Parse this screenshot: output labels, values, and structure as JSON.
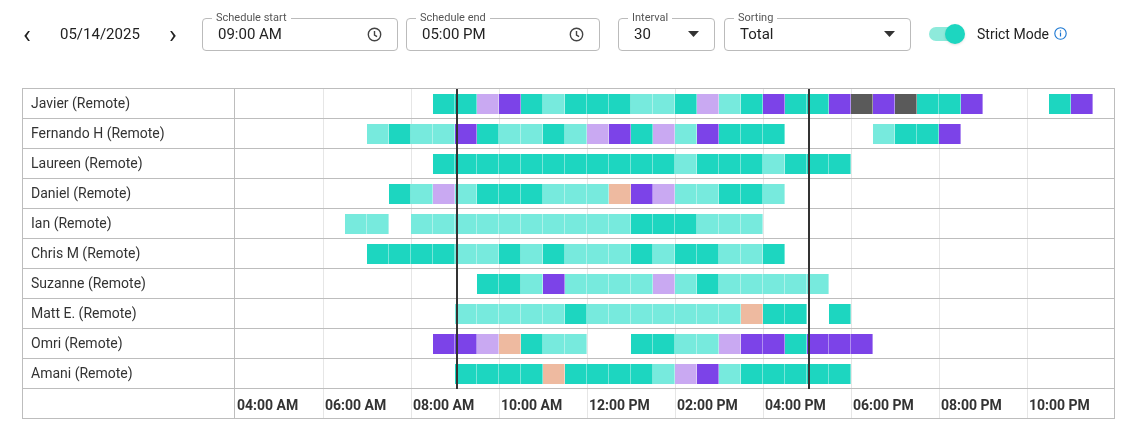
{
  "date_nav": {
    "prev": "‹",
    "date": "05/14/2025",
    "next": "›"
  },
  "schedule_start": {
    "label": "Schedule start",
    "value": "09:00 AM"
  },
  "schedule_end": {
    "label": "Schedule end",
    "value": "05:00 PM"
  },
  "interval": {
    "label": "Interval",
    "value": "30"
  },
  "sorting": {
    "label": "Sorting",
    "value": "Total"
  },
  "strict_mode": {
    "label": "Strict Mode",
    "on": true
  },
  "rows": [
    {
      "name": "Javier (Remote)",
      "slots": [
        {
          "kind": "gap"
        },
        {
          "kind": "gap"
        },
        {
          "kind": "gap"
        },
        {
          "kind": "gap"
        },
        {
          "kind": "gap"
        },
        {
          "kind": "gap"
        },
        {
          "kind": "gap"
        },
        {
          "kind": "gap"
        },
        {
          "kind": "gap"
        },
        {
          "kind": "shift",
          "color": "#1dd6c0"
        },
        {
          "kind": "shift",
          "color": "#1dd6c0"
        },
        {
          "kind": "shift",
          "color": "#c9a9f2"
        },
        {
          "kind": "shift",
          "color": "#7c43e8"
        },
        {
          "kind": "shift",
          "color": "#1dd6c0"
        },
        {
          "kind": "shift",
          "color": "#77eadd"
        },
        {
          "kind": "shift",
          "color": "#1dd6c0"
        },
        {
          "kind": "shift",
          "color": "#1dd6c0"
        },
        {
          "kind": "shift",
          "color": "#1dd6c0"
        },
        {
          "kind": "shift",
          "color": "#77eadd"
        },
        {
          "kind": "shift",
          "color": "#77eadd"
        },
        {
          "kind": "shift",
          "color": "#1dd6c0"
        },
        {
          "kind": "shift",
          "color": "#c9a9f2"
        },
        {
          "kind": "shift",
          "color": "#77eadd"
        },
        {
          "kind": "shift",
          "color": "#1dd6c0"
        },
        {
          "kind": "shift",
          "color": "#7c43e8"
        },
        {
          "kind": "shift",
          "color": "#1dd6c0"
        },
        {
          "kind": "shift",
          "color": "#1dd6c0"
        },
        {
          "kind": "shift",
          "color": "#7c43e8"
        },
        {
          "kind": "shift",
          "color": "#5a5a5a"
        },
        {
          "kind": "shift",
          "color": "#7c43e8"
        },
        {
          "kind": "shift",
          "color": "#5a5a5a"
        },
        {
          "kind": "shift",
          "color": "#1dd6c0"
        },
        {
          "kind": "shift",
          "color": "#1dd6c0"
        },
        {
          "kind": "shift",
          "color": "#7c43e8"
        },
        {
          "kind": "gap"
        },
        {
          "kind": "gap"
        },
        {
          "kind": "gap"
        },
        {
          "kind": "shift",
          "color": "#1dd6c0"
        },
        {
          "kind": "shift",
          "color": "#7c43e8"
        }
      ]
    },
    {
      "name": "Fernando H (Remote)",
      "slots": [
        {
          "kind": "gap"
        },
        {
          "kind": "gap"
        },
        {
          "kind": "gap"
        },
        {
          "kind": "gap"
        },
        {
          "kind": "gap"
        },
        {
          "kind": "gap"
        },
        {
          "kind": "shift",
          "color": "#77eadd"
        },
        {
          "kind": "shift",
          "color": "#1dd6c0"
        },
        {
          "kind": "shift",
          "color": "#77eadd"
        },
        {
          "kind": "shift",
          "color": "#77eadd"
        },
        {
          "kind": "shift",
          "color": "#7c43e8"
        },
        {
          "kind": "shift",
          "color": "#1dd6c0"
        },
        {
          "kind": "shift",
          "color": "#77eadd"
        },
        {
          "kind": "shift",
          "color": "#77eadd"
        },
        {
          "kind": "shift",
          "color": "#1dd6c0"
        },
        {
          "kind": "shift",
          "color": "#77eadd"
        },
        {
          "kind": "shift",
          "color": "#c9a9f2"
        },
        {
          "kind": "shift",
          "color": "#7c43e8"
        },
        {
          "kind": "shift",
          "color": "#1dd6c0"
        },
        {
          "kind": "shift",
          "color": "#c9a9f2"
        },
        {
          "kind": "shift",
          "color": "#77eadd"
        },
        {
          "kind": "shift",
          "color": "#7c43e8"
        },
        {
          "kind": "shift",
          "color": "#1dd6c0"
        },
        {
          "kind": "shift",
          "color": "#1dd6c0"
        },
        {
          "kind": "shift",
          "color": "#1dd6c0"
        },
        {
          "kind": "gap"
        },
        {
          "kind": "gap"
        },
        {
          "kind": "gap"
        },
        {
          "kind": "gap"
        },
        {
          "kind": "shift",
          "color": "#77eadd"
        },
        {
          "kind": "shift",
          "color": "#1dd6c0"
        },
        {
          "kind": "shift",
          "color": "#1dd6c0"
        },
        {
          "kind": "shift",
          "color": "#7c43e8"
        }
      ]
    },
    {
      "name": "Laureen (Remote)",
      "slots": [
        {
          "kind": "gap"
        },
        {
          "kind": "gap"
        },
        {
          "kind": "gap"
        },
        {
          "kind": "gap"
        },
        {
          "kind": "gap"
        },
        {
          "kind": "gap"
        },
        {
          "kind": "gap"
        },
        {
          "kind": "gap"
        },
        {
          "kind": "gap"
        },
        {
          "kind": "shift",
          "color": "#1dd6c0"
        },
        {
          "kind": "shift",
          "color": "#1dd6c0"
        },
        {
          "kind": "shift",
          "color": "#1dd6c0"
        },
        {
          "kind": "shift",
          "color": "#1dd6c0"
        },
        {
          "kind": "shift",
          "color": "#1dd6c0"
        },
        {
          "kind": "shift",
          "color": "#1dd6c0"
        },
        {
          "kind": "shift",
          "color": "#1dd6c0"
        },
        {
          "kind": "shift",
          "color": "#1dd6c0"
        },
        {
          "kind": "shift",
          "color": "#1dd6c0"
        },
        {
          "kind": "shift",
          "color": "#1dd6c0"
        },
        {
          "kind": "shift",
          "color": "#1dd6c0"
        },
        {
          "kind": "shift",
          "color": "#77eadd"
        },
        {
          "kind": "shift",
          "color": "#1dd6c0"
        },
        {
          "kind": "shift",
          "color": "#1dd6c0"
        },
        {
          "kind": "shift",
          "color": "#1dd6c0"
        },
        {
          "kind": "shift",
          "color": "#77eadd"
        },
        {
          "kind": "shift",
          "color": "#1dd6c0"
        },
        {
          "kind": "shift",
          "color": "#1dd6c0"
        },
        {
          "kind": "shift",
          "color": "#1dd6c0"
        }
      ]
    },
    {
      "name": "Daniel (Remote)",
      "slots": [
        {
          "kind": "gap"
        },
        {
          "kind": "gap"
        },
        {
          "kind": "gap"
        },
        {
          "kind": "gap"
        },
        {
          "kind": "gap"
        },
        {
          "kind": "gap"
        },
        {
          "kind": "gap"
        },
        {
          "kind": "shift",
          "color": "#1dd6c0"
        },
        {
          "kind": "shift",
          "color": "#77eadd"
        },
        {
          "kind": "shift",
          "color": "#c9a9f2"
        },
        {
          "kind": "shift",
          "color": "#77eadd"
        },
        {
          "kind": "shift",
          "color": "#1dd6c0"
        },
        {
          "kind": "shift",
          "color": "#1dd6c0"
        },
        {
          "kind": "shift",
          "color": "#1dd6c0"
        },
        {
          "kind": "shift",
          "color": "#77eadd"
        },
        {
          "kind": "shift",
          "color": "#77eadd"
        },
        {
          "kind": "shift",
          "color": "#77eadd"
        },
        {
          "kind": "shift",
          "color": "#eebaa0"
        },
        {
          "kind": "shift",
          "color": "#7c43e8"
        },
        {
          "kind": "shift",
          "color": "#c9a9f2"
        },
        {
          "kind": "shift",
          "color": "#77eadd"
        },
        {
          "kind": "shift",
          "color": "#77eadd"
        },
        {
          "kind": "shift",
          "color": "#1dd6c0"
        },
        {
          "kind": "shift",
          "color": "#1dd6c0"
        },
        {
          "kind": "shift",
          "color": "#77eadd"
        }
      ]
    },
    {
      "name": "Ian (Remote)",
      "slots": [
        {
          "kind": "gap"
        },
        {
          "kind": "gap"
        },
        {
          "kind": "gap"
        },
        {
          "kind": "gap"
        },
        {
          "kind": "gap"
        },
        {
          "kind": "shift",
          "color": "#77eadd"
        },
        {
          "kind": "shift",
          "color": "#77eadd"
        },
        {
          "kind": "gap"
        },
        {
          "kind": "shift",
          "color": "#77eadd"
        },
        {
          "kind": "shift",
          "color": "#77eadd"
        },
        {
          "kind": "shift",
          "color": "#77eadd"
        },
        {
          "kind": "shift",
          "color": "#77eadd"
        },
        {
          "kind": "shift",
          "color": "#77eadd"
        },
        {
          "kind": "shift",
          "color": "#77eadd"
        },
        {
          "kind": "shift",
          "color": "#77eadd"
        },
        {
          "kind": "shift",
          "color": "#77eadd"
        },
        {
          "kind": "shift",
          "color": "#77eadd"
        },
        {
          "kind": "shift",
          "color": "#77eadd"
        },
        {
          "kind": "shift",
          "color": "#1dd6c0"
        },
        {
          "kind": "shift",
          "color": "#1dd6c0"
        },
        {
          "kind": "shift",
          "color": "#1dd6c0"
        },
        {
          "kind": "shift",
          "color": "#77eadd"
        },
        {
          "kind": "shift",
          "color": "#77eadd"
        },
        {
          "kind": "shift",
          "color": "#77eadd"
        }
      ]
    },
    {
      "name": "Chris M (Remote)",
      "slots": [
        {
          "kind": "gap"
        },
        {
          "kind": "gap"
        },
        {
          "kind": "gap"
        },
        {
          "kind": "gap"
        },
        {
          "kind": "gap"
        },
        {
          "kind": "gap"
        },
        {
          "kind": "shift",
          "color": "#1dd6c0"
        },
        {
          "kind": "shift",
          "color": "#1dd6c0"
        },
        {
          "kind": "shift",
          "color": "#1dd6c0"
        },
        {
          "kind": "shift",
          "color": "#1dd6c0"
        },
        {
          "kind": "shift",
          "color": "#77eadd"
        },
        {
          "kind": "shift",
          "color": "#77eadd"
        },
        {
          "kind": "shift",
          "color": "#1dd6c0"
        },
        {
          "kind": "shift",
          "color": "#77eadd"
        },
        {
          "kind": "shift",
          "color": "#1dd6c0"
        },
        {
          "kind": "shift",
          "color": "#77eadd"
        },
        {
          "kind": "shift",
          "color": "#77eadd"
        },
        {
          "kind": "shift",
          "color": "#77eadd"
        },
        {
          "kind": "shift",
          "color": "#1dd6c0"
        },
        {
          "kind": "shift",
          "color": "#77eadd"
        },
        {
          "kind": "shift",
          "color": "#1dd6c0"
        },
        {
          "kind": "shift",
          "color": "#1dd6c0"
        },
        {
          "kind": "shift",
          "color": "#77eadd"
        },
        {
          "kind": "shift",
          "color": "#77eadd"
        },
        {
          "kind": "shift",
          "color": "#1dd6c0"
        }
      ]
    },
    {
      "name": "Suzanne (Remote)",
      "slots": [
        {
          "kind": "gap"
        },
        {
          "kind": "gap"
        },
        {
          "kind": "gap"
        },
        {
          "kind": "gap"
        },
        {
          "kind": "gap"
        },
        {
          "kind": "gap"
        },
        {
          "kind": "gap"
        },
        {
          "kind": "gap"
        },
        {
          "kind": "gap"
        },
        {
          "kind": "gap"
        },
        {
          "kind": "gap"
        },
        {
          "kind": "shift",
          "color": "#1dd6c0"
        },
        {
          "kind": "shift",
          "color": "#1dd6c0"
        },
        {
          "kind": "shift",
          "color": "#77eadd"
        },
        {
          "kind": "shift",
          "color": "#7c43e8"
        },
        {
          "kind": "shift",
          "color": "#77eadd"
        },
        {
          "kind": "shift",
          "color": "#77eadd"
        },
        {
          "kind": "shift",
          "color": "#77eadd"
        },
        {
          "kind": "shift",
          "color": "#77eadd"
        },
        {
          "kind": "shift",
          "color": "#c9a9f2"
        },
        {
          "kind": "shift",
          "color": "#77eadd"
        },
        {
          "kind": "shift",
          "color": "#1dd6c0"
        },
        {
          "kind": "shift",
          "color": "#77eadd"
        },
        {
          "kind": "shift",
          "color": "#77eadd"
        },
        {
          "kind": "shift",
          "color": "#77eadd"
        },
        {
          "kind": "shift",
          "color": "#77eadd"
        },
        {
          "kind": "shift",
          "color": "#77eadd"
        }
      ]
    },
    {
      "name": "Matt E. (Remote)",
      "slots": [
        {
          "kind": "gap"
        },
        {
          "kind": "gap"
        },
        {
          "kind": "gap"
        },
        {
          "kind": "gap"
        },
        {
          "kind": "gap"
        },
        {
          "kind": "gap"
        },
        {
          "kind": "gap"
        },
        {
          "kind": "gap"
        },
        {
          "kind": "gap"
        },
        {
          "kind": "gap"
        },
        {
          "kind": "shift",
          "color": "#77eadd"
        },
        {
          "kind": "shift",
          "color": "#77eadd"
        },
        {
          "kind": "shift",
          "color": "#77eadd"
        },
        {
          "kind": "shift",
          "color": "#77eadd"
        },
        {
          "kind": "shift",
          "color": "#77eadd"
        },
        {
          "kind": "shift",
          "color": "#1dd6c0"
        },
        {
          "kind": "shift",
          "color": "#77eadd"
        },
        {
          "kind": "shift",
          "color": "#77eadd"
        },
        {
          "kind": "shift",
          "color": "#77eadd"
        },
        {
          "kind": "shift",
          "color": "#77eadd"
        },
        {
          "kind": "shift",
          "color": "#77eadd"
        },
        {
          "kind": "shift",
          "color": "#77eadd"
        },
        {
          "kind": "shift",
          "color": "#77eadd"
        },
        {
          "kind": "shift",
          "color": "#eebaa0"
        },
        {
          "kind": "shift",
          "color": "#1dd6c0"
        },
        {
          "kind": "shift",
          "color": "#1dd6c0"
        },
        {
          "kind": "gap"
        },
        {
          "kind": "shift",
          "color": "#1dd6c0"
        }
      ]
    },
    {
      "name": "Omri (Remote)",
      "slots": [
        {
          "kind": "gap"
        },
        {
          "kind": "gap"
        },
        {
          "kind": "gap"
        },
        {
          "kind": "gap"
        },
        {
          "kind": "gap"
        },
        {
          "kind": "gap"
        },
        {
          "kind": "gap"
        },
        {
          "kind": "gap"
        },
        {
          "kind": "gap"
        },
        {
          "kind": "shift",
          "color": "#7c43e8"
        },
        {
          "kind": "shift",
          "color": "#7c43e8"
        },
        {
          "kind": "shift",
          "color": "#c9a9f2"
        },
        {
          "kind": "shift",
          "color": "#eebaa0"
        },
        {
          "kind": "shift",
          "color": "#1dd6c0"
        },
        {
          "kind": "shift",
          "color": "#77eadd"
        },
        {
          "kind": "shift",
          "color": "#77eadd"
        },
        {
          "kind": "gap"
        },
        {
          "kind": "gap"
        },
        {
          "kind": "shift",
          "color": "#1dd6c0"
        },
        {
          "kind": "shift",
          "color": "#1dd6c0"
        },
        {
          "kind": "shift",
          "color": "#77eadd"
        },
        {
          "kind": "shift",
          "color": "#77eadd"
        },
        {
          "kind": "shift",
          "color": "#c9a9f2"
        },
        {
          "kind": "shift",
          "color": "#7c43e8"
        },
        {
          "kind": "shift",
          "color": "#7c43e8"
        },
        {
          "kind": "shift",
          "color": "#1dd6c0"
        },
        {
          "kind": "shift",
          "color": "#7c43e8"
        },
        {
          "kind": "shift",
          "color": "#7c43e8"
        },
        {
          "kind": "shift",
          "color": "#7c43e8"
        }
      ]
    },
    {
      "name": "Amani (Remote)",
      "slots": [
        {
          "kind": "gap"
        },
        {
          "kind": "gap"
        },
        {
          "kind": "gap"
        },
        {
          "kind": "gap"
        },
        {
          "kind": "gap"
        },
        {
          "kind": "gap"
        },
        {
          "kind": "gap"
        },
        {
          "kind": "gap"
        },
        {
          "kind": "gap"
        },
        {
          "kind": "gap"
        },
        {
          "kind": "shift",
          "color": "#1dd6c0"
        },
        {
          "kind": "shift",
          "color": "#1dd6c0"
        },
        {
          "kind": "shift",
          "color": "#1dd6c0"
        },
        {
          "kind": "shift",
          "color": "#1dd6c0"
        },
        {
          "kind": "shift",
          "color": "#eebaa0"
        },
        {
          "kind": "shift",
          "color": "#1dd6c0"
        },
        {
          "kind": "shift",
          "color": "#1dd6c0"
        },
        {
          "kind": "shift",
          "color": "#1dd6c0"
        },
        {
          "kind": "shift",
          "color": "#1dd6c0"
        },
        {
          "kind": "shift",
          "color": "#77eadd"
        },
        {
          "kind": "shift",
          "color": "#c9a9f2"
        },
        {
          "kind": "shift",
          "color": "#7c43e8"
        },
        {
          "kind": "shift",
          "color": "#77eadd"
        },
        {
          "kind": "shift",
          "color": "#1dd6c0"
        },
        {
          "kind": "shift",
          "color": "#1dd6c0"
        },
        {
          "kind": "shift",
          "color": "#1dd6c0"
        },
        {
          "kind": "shift",
          "color": "#1dd6c0"
        },
        {
          "kind": "shift",
          "color": "#1dd6c0"
        }
      ]
    }
  ],
  "axis_labels": [
    "04:00 AM",
    "06:00 AM",
    "08:00 AM",
    "10:00 AM",
    "12:00 PM",
    "02:00 PM",
    "04:00 PM",
    "06:00 PM",
    "08:00 PM",
    "10:00 PM"
  ]
}
